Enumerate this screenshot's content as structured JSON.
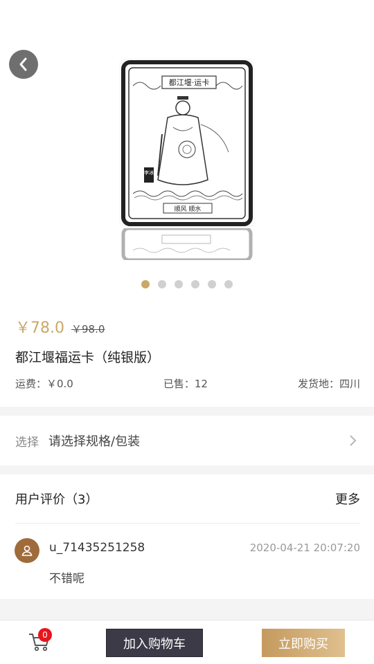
{
  "gallery": {
    "card_title": "都江堰·运卡",
    "card_motto": "顺风 顺水",
    "card_seal": "李冰",
    "dot_count": 6,
    "active_index": 0
  },
  "product": {
    "price": "￥78.0",
    "original_price": "￥98.0",
    "title": "都江堰福运卡（纯银版）",
    "shipping": "运费：￥0.0",
    "sold": "已售：12",
    "origin": "发货地：四川"
  },
  "spec": {
    "label": "选择",
    "value": "请选择规格/包装"
  },
  "reviews": {
    "header": "用户评价（3）",
    "more": "更多",
    "items": [
      {
        "user": "u_71435251258",
        "time": "2020-04-21 20:07:20",
        "text": "不错呢"
      }
    ]
  },
  "bottom": {
    "cart_count": "0",
    "add_to_cart": "加入购物车",
    "buy_now": "立即购买"
  },
  "colors": {
    "accent_gold": "#c9a86a",
    "dark_button": "#3b3a46",
    "badge_red": "#e8151d",
    "avatar_brown": "#a06b3a"
  }
}
